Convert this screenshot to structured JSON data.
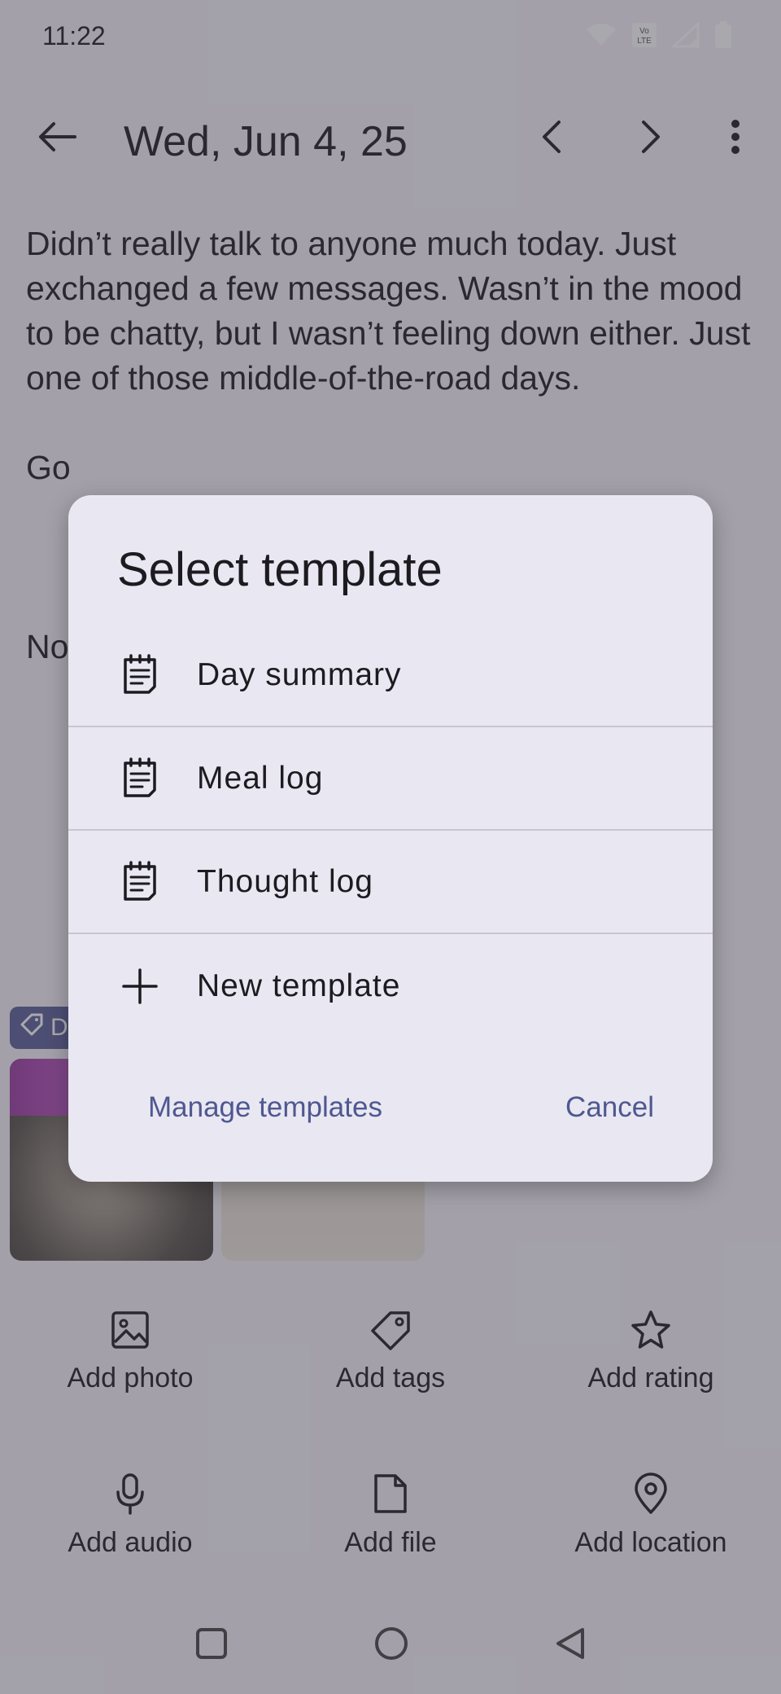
{
  "status_bar": {
    "time": "11:22",
    "network_badge": "Vo LTE"
  },
  "app_bar": {
    "title": "Wed, Jun 4, 25"
  },
  "entry": {
    "paragraphs": [
      "Didn’t really talk to anyone much today. Just exchanged a few messages. Wasn’t in the mood to be chatty, but I wasn’t feeling down either. Just one of those middle-of-the-road days.",
      "Go",
      "No"
    ]
  },
  "tag": {
    "label": "D"
  },
  "actions": {
    "add_photo": "Add photo",
    "add_tags": "Add tags",
    "add_rating": "Add rating",
    "add_audio": "Add audio",
    "add_file": "Add file",
    "add_location": "Add location"
  },
  "dialog": {
    "title": "Select template",
    "templates": [
      {
        "label": "Day summary",
        "icon": "note-icon"
      },
      {
        "label": "Meal log",
        "icon": "note-icon"
      },
      {
        "label": "Thought log",
        "icon": "note-icon"
      },
      {
        "label": "New template",
        "icon": "plus-icon"
      }
    ],
    "manage_label": "Manage templates",
    "cancel_label": "Cancel"
  },
  "colors": {
    "accent": "#4e5891",
    "dialog_bg": "#e9e7f1",
    "chip_bg": "#5b5f9a"
  }
}
